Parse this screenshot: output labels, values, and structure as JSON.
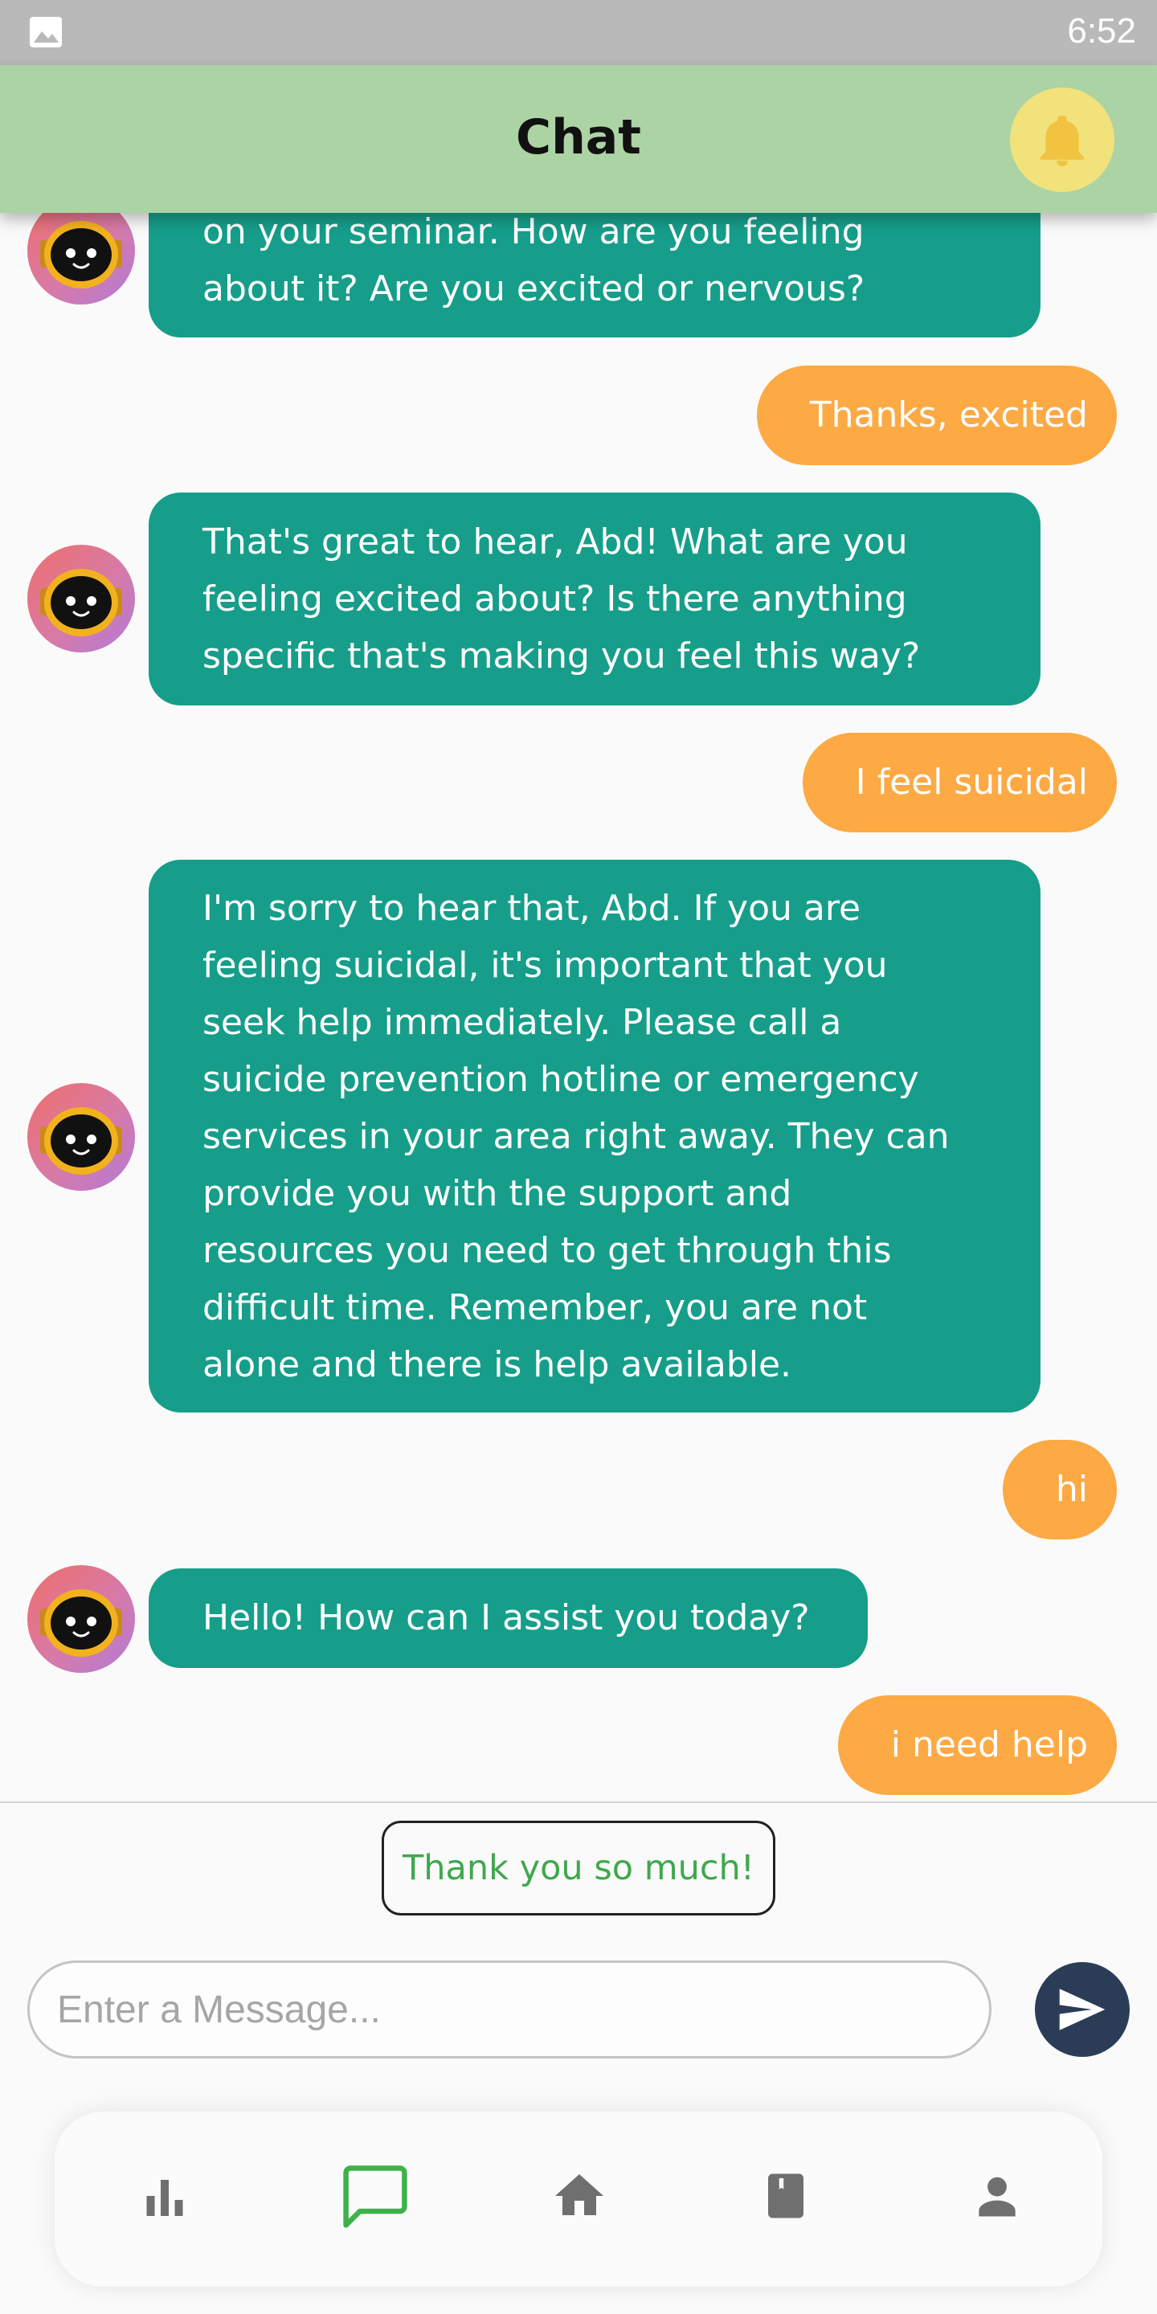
{
  "status_bar": {
    "time": "6:52",
    "left_icon": "image-icon"
  },
  "header": {
    "title": "Chat",
    "bell_icon": "bell-icon",
    "bell_color": "#f2e27c",
    "background": "#acd3a4"
  },
  "messages": [
    {
      "sender": "bot",
      "lines": [
        "on your seminar. How are you feeling",
        "about it? Are you excited or nervous?"
      ]
    },
    {
      "sender": "user",
      "text": "Thanks, excited"
    },
    {
      "sender": "bot",
      "lines": [
        "That's great to hear, Abd! What are you",
        "feeling excited about? Is there anything",
        "specific that's making you feel this way?"
      ]
    },
    {
      "sender": "user",
      "text": "I feel suicidal"
    },
    {
      "sender": "bot",
      "lines": [
        "I'm sorry to hear that, Abd. If you are",
        "feeling suicidal, it's important that you",
        "seek help immediately. Please call a",
        "suicide prevention hotline or emergency",
        "services in your area right away. They can",
        "provide you with the support and",
        "resources you need to get through this",
        "difficult time. Remember, you are not",
        "alone and there is help available."
      ]
    },
    {
      "sender": "user",
      "text": "hi"
    },
    {
      "sender": "bot",
      "lines": [
        "Hello! How can I assist you today?"
      ]
    },
    {
      "sender": "user",
      "text": "i need help"
    }
  ],
  "suggestion": {
    "label": "Thank you so much!"
  },
  "composer": {
    "placeholder": "Enter a Message...",
    "value": "",
    "send_icon": "send-icon"
  },
  "bottom_nav": {
    "items": [
      {
        "icon": "bar-chart-icon",
        "active": false
      },
      {
        "icon": "chat-icon",
        "active": true
      },
      {
        "icon": "home-icon",
        "active": false
      },
      {
        "icon": "book-icon",
        "active": false
      },
      {
        "icon": "person-icon",
        "active": false
      }
    ]
  },
  "colors": {
    "bot_bubble": "#169e8a",
    "user_bubble": "#fda944",
    "nav_active": "#3fb14a",
    "nav_inactive": "#6f6f6f",
    "send_button": "#2b3d56"
  }
}
